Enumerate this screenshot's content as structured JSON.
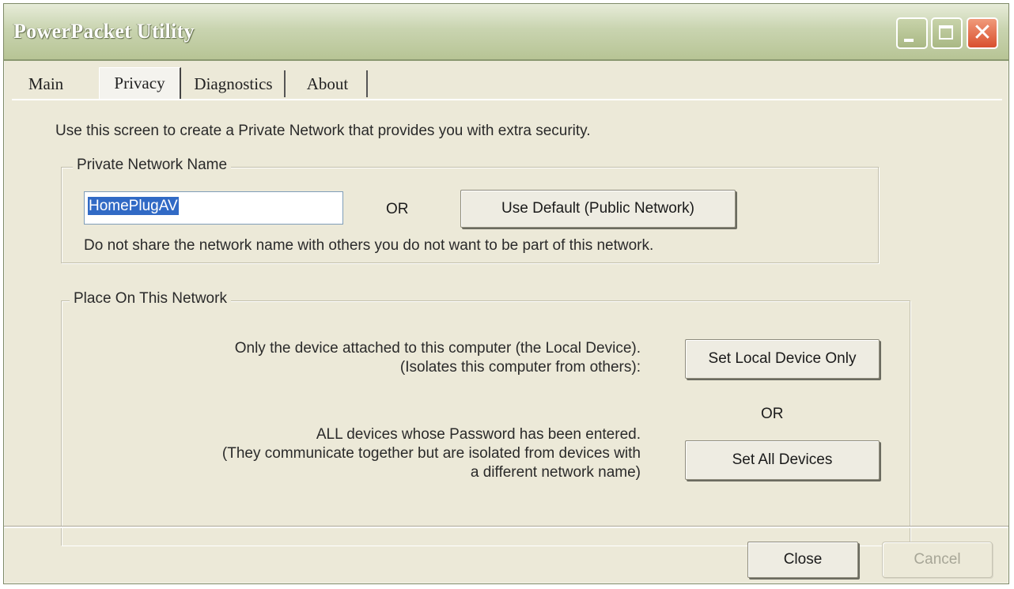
{
  "window": {
    "title": "PowerPacket Utility"
  },
  "titlebar_buttons": {
    "minimize": "minimize-icon",
    "maximize": "maximize-icon",
    "close_glyph": "✕"
  },
  "tabs": [
    {
      "label": "Main",
      "active": false
    },
    {
      "label": "Privacy",
      "active": true
    },
    {
      "label": "Diagnostics",
      "active": false
    },
    {
      "label": "About",
      "active": false
    }
  ],
  "privacy": {
    "intro": "Use this screen to create a Private Network that provides you with extra security.",
    "network_name_group": {
      "legend": "Private Network Name",
      "input_value": "HomePlugAV",
      "or_label": "OR",
      "use_default_label": "Use Default (Public Network)",
      "warning": "Do not share the network name with others you do not want to be part of this network."
    },
    "place_group": {
      "legend": "Place On This Network",
      "local_line1": "Only the device attached to this computer (the Local Device).",
      "local_line2": "(Isolates this computer from others):",
      "set_local_label": "Set Local Device Only",
      "or_label": "OR",
      "all_line1": "ALL devices whose Password has been entered.",
      "all_line2": "(They communicate together but are isolated from devices with",
      "all_line3": "a different network name)",
      "set_all_label": "Set All Devices"
    }
  },
  "footer": {
    "close_label": "Close",
    "cancel_label": "Cancel"
  },
  "colors": {
    "selection": "#316ac5",
    "dialog_bg": "#ece9d8",
    "close_button": "#d9502e"
  }
}
